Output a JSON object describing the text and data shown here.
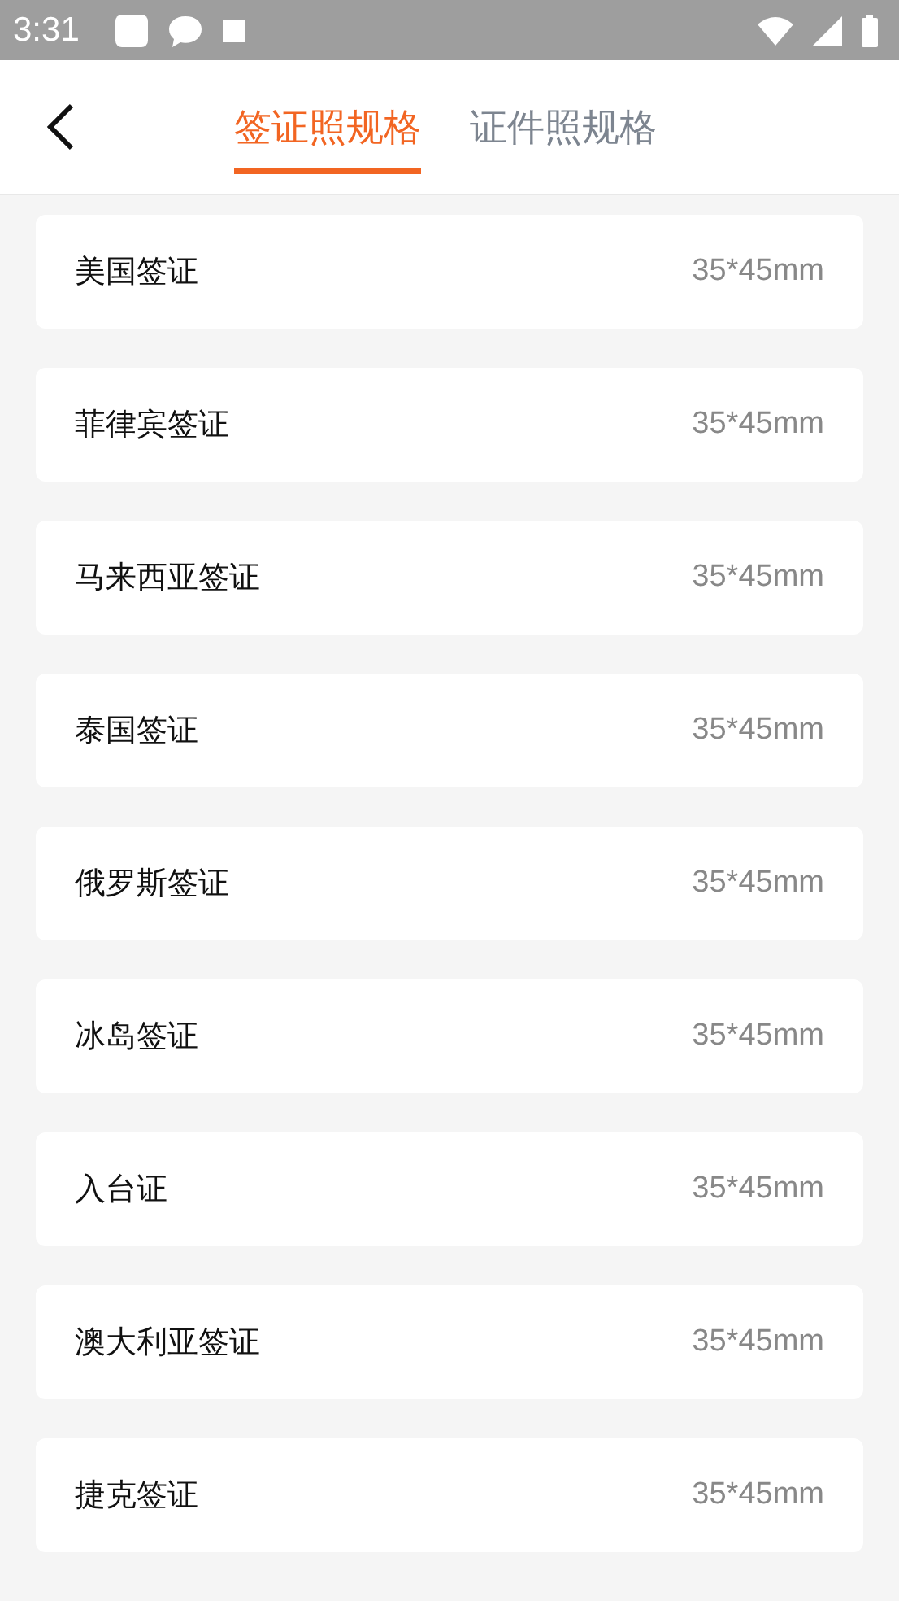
{
  "status_bar": {
    "time": "3:31"
  },
  "tabs": [
    {
      "label": "签证照规格",
      "selected": true
    },
    {
      "label": "证件照规格",
      "selected": false
    }
  ],
  "items": [
    {
      "name": "美国签证",
      "size": "35*45mm"
    },
    {
      "name": "菲律宾签证",
      "size": "35*45mm"
    },
    {
      "name": "马来西亚签证",
      "size": "35*45mm"
    },
    {
      "name": "泰国签证",
      "size": "35*45mm"
    },
    {
      "name": "俄罗斯签证",
      "size": "35*45mm"
    },
    {
      "name": "冰岛签证",
      "size": "35*45mm"
    },
    {
      "name": "入台证",
      "size": "35*45mm"
    },
    {
      "name": "澳大利亚签证",
      "size": "35*45mm"
    },
    {
      "name": "捷克签证",
      "size": "35*45mm"
    }
  ]
}
